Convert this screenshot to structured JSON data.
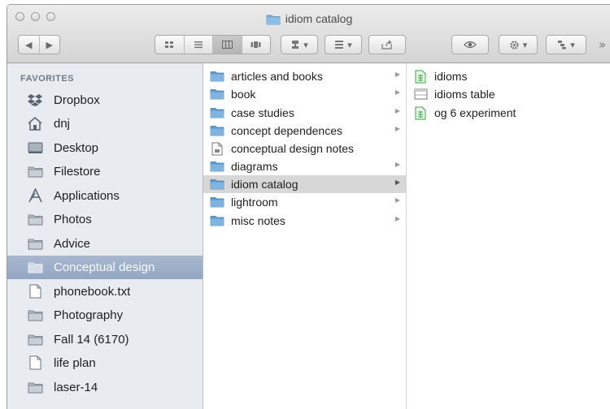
{
  "window": {
    "title": "idiom catalog"
  },
  "toolbar": {
    "back_icon": "back-arrow",
    "forward_icon": "forward-arrow",
    "view_modes": [
      "icon-view",
      "list-view",
      "column-view",
      "cover-flow-view"
    ],
    "active_view": "column-view",
    "arrange_icon": "arrange-menu",
    "group_icon": "group-menu",
    "share_icon": "share-icon",
    "quicklook_icon": "eye-icon",
    "action_icon": "gear-icon",
    "path_icon": "path-menu",
    "overflow": "»"
  },
  "sidebar": {
    "heading": "FAVORITES",
    "items": [
      {
        "label": "Dropbox",
        "icon": "dropbox-icon"
      },
      {
        "label": "dnj",
        "icon": "home-icon"
      },
      {
        "label": "Desktop",
        "icon": "desktop-icon"
      },
      {
        "label": "Filestore",
        "icon": "folder-icon"
      },
      {
        "label": "Applications",
        "icon": "applications-icon"
      },
      {
        "label": "Photos",
        "icon": "folder-icon"
      },
      {
        "label": "Advice",
        "icon": "folder-icon"
      },
      {
        "label": "Conceptual design",
        "icon": "folder-icon",
        "selected": true
      },
      {
        "label": "phonebook.txt",
        "icon": "document-icon"
      },
      {
        "label": "Photography",
        "icon": "folder-icon"
      },
      {
        "label": "Fall 14 (6170)",
        "icon": "folder-icon"
      },
      {
        "label": "life plan",
        "icon": "document-icon"
      },
      {
        "label": "laser-14",
        "icon": "folder-icon"
      }
    ]
  },
  "column1": {
    "items": [
      {
        "label": "articles and books",
        "icon": "folder-icon",
        "has_children": true
      },
      {
        "label": "book",
        "icon": "folder-icon",
        "has_children": true
      },
      {
        "label": "case studies",
        "icon": "folder-icon",
        "has_children": true
      },
      {
        "label": "concept dependences",
        "icon": "folder-icon",
        "has_children": true
      },
      {
        "label": "conceptual design notes",
        "icon": "document-icon",
        "has_children": false
      },
      {
        "label": "diagrams",
        "icon": "folder-icon",
        "has_children": true
      },
      {
        "label": "idiom catalog",
        "icon": "folder-icon",
        "has_children": true,
        "selected": true
      },
      {
        "label": "lightroom",
        "icon": "folder-icon",
        "has_children": true
      },
      {
        "label": "misc notes",
        "icon": "folder-icon",
        "has_children": true
      }
    ]
  },
  "column2": {
    "items": [
      {
        "label": "idioms",
        "icon": "spreadsheet-icon"
      },
      {
        "label": "idioms table",
        "icon": "table-document-icon"
      },
      {
        "label": "og 6 experiment",
        "icon": "spreadsheet-icon"
      }
    ]
  },
  "colors": {
    "folder_blue": "#6fa8d8",
    "sidebar_bg": "#e8ecf1",
    "selection_sidebar": "#9fb0c9",
    "selection_column": "#d7d7d7",
    "spreadsheet_green": "#3aa34a"
  }
}
